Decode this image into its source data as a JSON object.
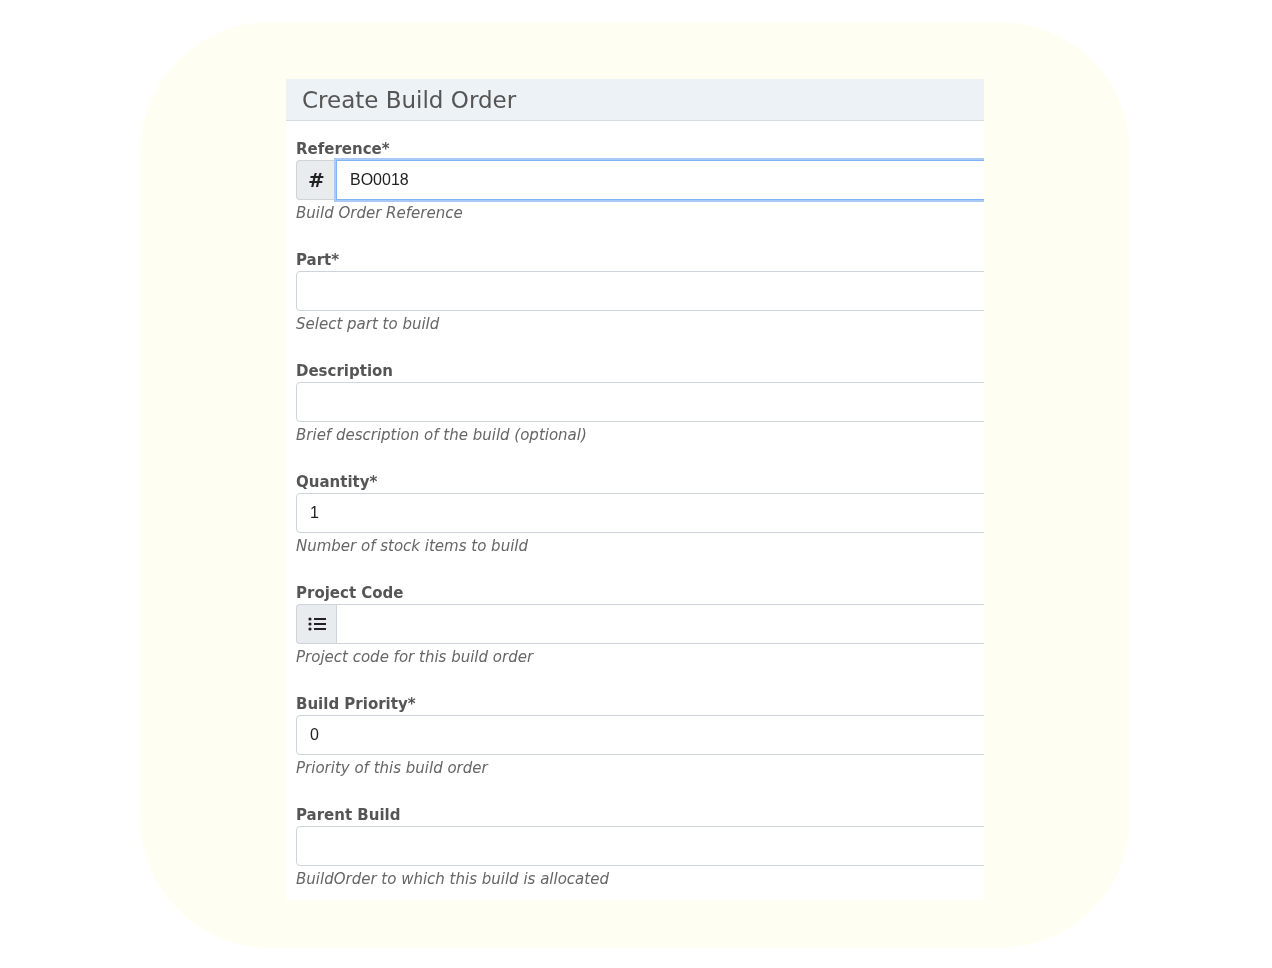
{
  "title": "Create Build Order",
  "fields": [
    {
      "kind": "hash",
      "label": "Reference*",
      "prefix": "#",
      "value": "BO0018",
      "help": "Build Order Reference",
      "focused": true
    },
    {
      "kind": "plain",
      "label": "Part*",
      "help": "Select part to build",
      "focused": false
    },
    {
      "kind": "plain",
      "label": "Description",
      "help": "Brief description of the build (optional)",
      "focused": false
    },
    {
      "kind": "plain",
      "label": "Quantity*",
      "value": "1",
      "help": "Number of stock items to build",
      "focused": false
    },
    {
      "kind": "icon",
      "label": "Project Code",
      "help": "Project code for this build order",
      "focused": false
    },
    {
      "kind": "plain",
      "label": "Build Priority*",
      "value": "0",
      "help": "Priority of this build order",
      "focused": false
    },
    {
      "kind": "plain",
      "label": "Parent Build",
      "help": "BuildOrder to which this build is allocated",
      "focused": false
    }
  ]
}
